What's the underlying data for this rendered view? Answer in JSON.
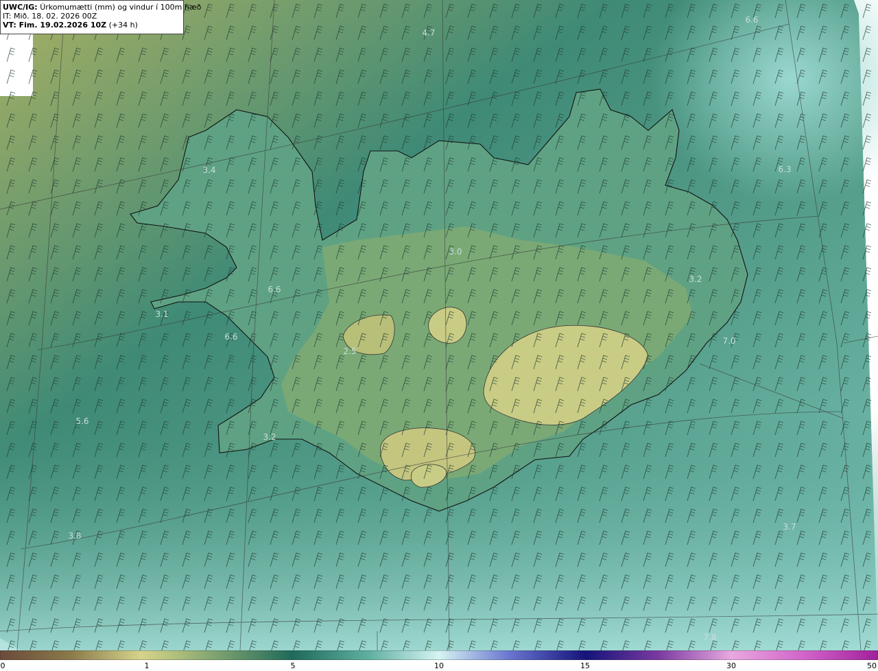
{
  "header": {
    "product": "UWC/IG:",
    "title": "Úrkomumætti (mm) og vindur í 100m hæð",
    "it_line": "IT: Mið. 18. 02. 2026 00Z",
    "vt_prefix": "VT: Fim. 19.02.2026 10Z",
    "vt_offset": "(+34 h)"
  },
  "map_labels": [
    {
      "id": "n1",
      "text": "4.7"
    },
    {
      "id": "n2",
      "text": "6.6"
    },
    {
      "id": "n3",
      "text": "3.4"
    },
    {
      "id": "n4",
      "text": "6.3"
    },
    {
      "id": "n5",
      "text": "3.0"
    },
    {
      "id": "n6",
      "text": "3.2"
    },
    {
      "id": "n7",
      "text": "6.6"
    },
    {
      "id": "n8",
      "text": "3.1"
    },
    {
      "id": "n9",
      "text": "6.6"
    },
    {
      "id": "n10",
      "text": "7.0"
    },
    {
      "id": "n11",
      "text": "2.5"
    },
    {
      "id": "n12",
      "text": "5.6"
    },
    {
      "id": "n13",
      "text": "3.2"
    },
    {
      "id": "n14",
      "text": "3.8"
    },
    {
      "id": "n15",
      "text": "3.7"
    },
    {
      "id": "n16",
      "text": "7.8"
    }
  ],
  "colorbar": {
    "ticks": [
      "0",
      "1",
      "5",
      "10",
      "15",
      "30",
      "50"
    ],
    "colors": [
      "#6b4a3a",
      "#8a7a4a",
      "#c8c67a",
      "#e4e09a",
      "#2f7a68",
      "#1f6a5a",
      "#8fd4cc",
      "#d6f4f2",
      "#2b2fa0",
      "#1a1a7a",
      "#9a3aa8",
      "#e08ad8",
      "#a0209a"
    ]
  },
  "palette": {
    "land_light": "#b8c07a",
    "sea_teal": "#3e8c78",
    "sea_light": "#8fcfc2",
    "coast": "#111111"
  }
}
